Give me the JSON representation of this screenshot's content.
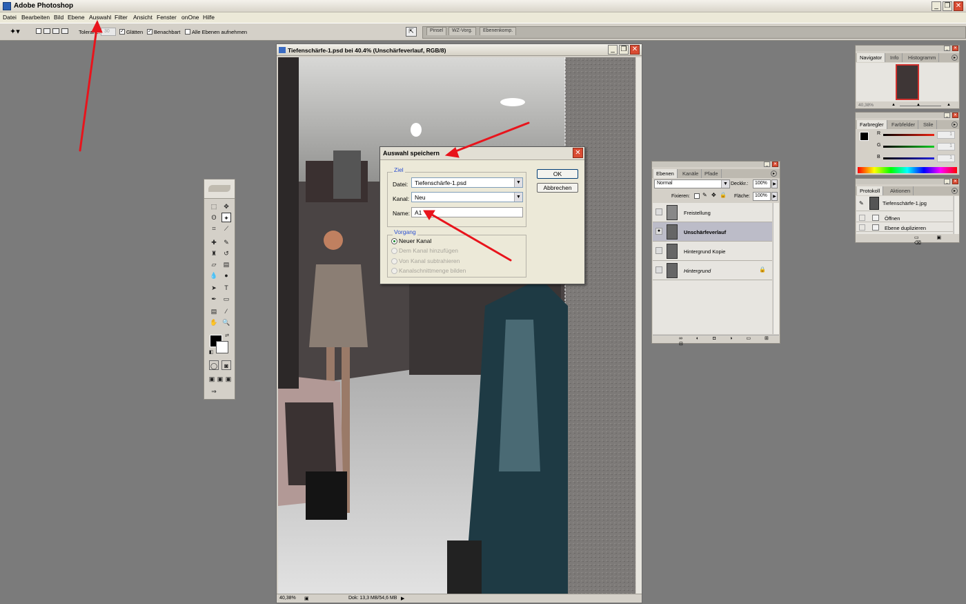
{
  "app": {
    "title": "Adobe Photoshop"
  },
  "menu": [
    "Datei",
    "Bearbeiten",
    "Bild",
    "Ebene",
    "Auswahl",
    "Filter",
    "Ansicht",
    "Fenster",
    "onOne",
    "Hilfe"
  ],
  "options": {
    "tolerance_label": "Toleranz:",
    "tolerance_value": "30",
    "smooth": "Glätten",
    "contiguous": "Benachbart",
    "all_layers": "Alle Ebenen aufnehmen"
  },
  "palette_well": [
    "Pinsel",
    "WZ-Vorg.",
    "Ebenenkomp."
  ],
  "document": {
    "title": "Tiefenschärfe-1.psd bei 40.4% (Unschärfeverlauf, RGB/8)",
    "zoom": "40,38%",
    "doc_size": "Dok: 13,3 MB/54,6 MB"
  },
  "dialog": {
    "title": "Auswahl speichern",
    "group_target": "Ziel",
    "file_label": "Datei:",
    "file_value": "Tiefenschärfe-1.psd",
    "channel_label": "Kanal:",
    "channel_value": "Neu",
    "name_label": "Name:",
    "name_value": "A1",
    "group_operation": "Vorgang",
    "ops": [
      "Neuer Kanal",
      "Dem Kanal hinzufügen",
      "Von Kanal subtrahieren",
      "Kanalschnittmenge bilden"
    ],
    "ok": "OK",
    "cancel": "Abbrechen"
  },
  "layers_panel": {
    "tabs": [
      "Ebenen",
      "Kanäle",
      "Pfade"
    ],
    "blend_mode": "Normal",
    "opacity_label": "Deckkr.:",
    "opacity": "100%",
    "lock_label": "Fixieren:",
    "fill_label": "Fläche:",
    "fill": "100%",
    "layers": [
      "Freistellung",
      "Unschärfeverlauf",
      "Hintergrund Kopie",
      "Hintergrund"
    ]
  },
  "navigator": {
    "tabs": [
      "Navigator",
      "Info",
      "Histogramm"
    ],
    "zoom": "40,38%"
  },
  "color_panel": {
    "tabs": [
      "Farbregler",
      "Farbfelder",
      "Stile"
    ],
    "channels": [
      "R",
      "G",
      "B"
    ],
    "values": [
      "1",
      "1",
      "1"
    ]
  },
  "history": {
    "tabs": [
      "Protokoll",
      "Aktionen"
    ],
    "snapshot": "Tiefenschärfe-1.jpg",
    "steps": [
      "Öffnen",
      "Ebene duplizieren"
    ]
  },
  "colors": {
    "workspace": "#7b7b7b",
    "annotation_arrow": "#e8141c"
  }
}
